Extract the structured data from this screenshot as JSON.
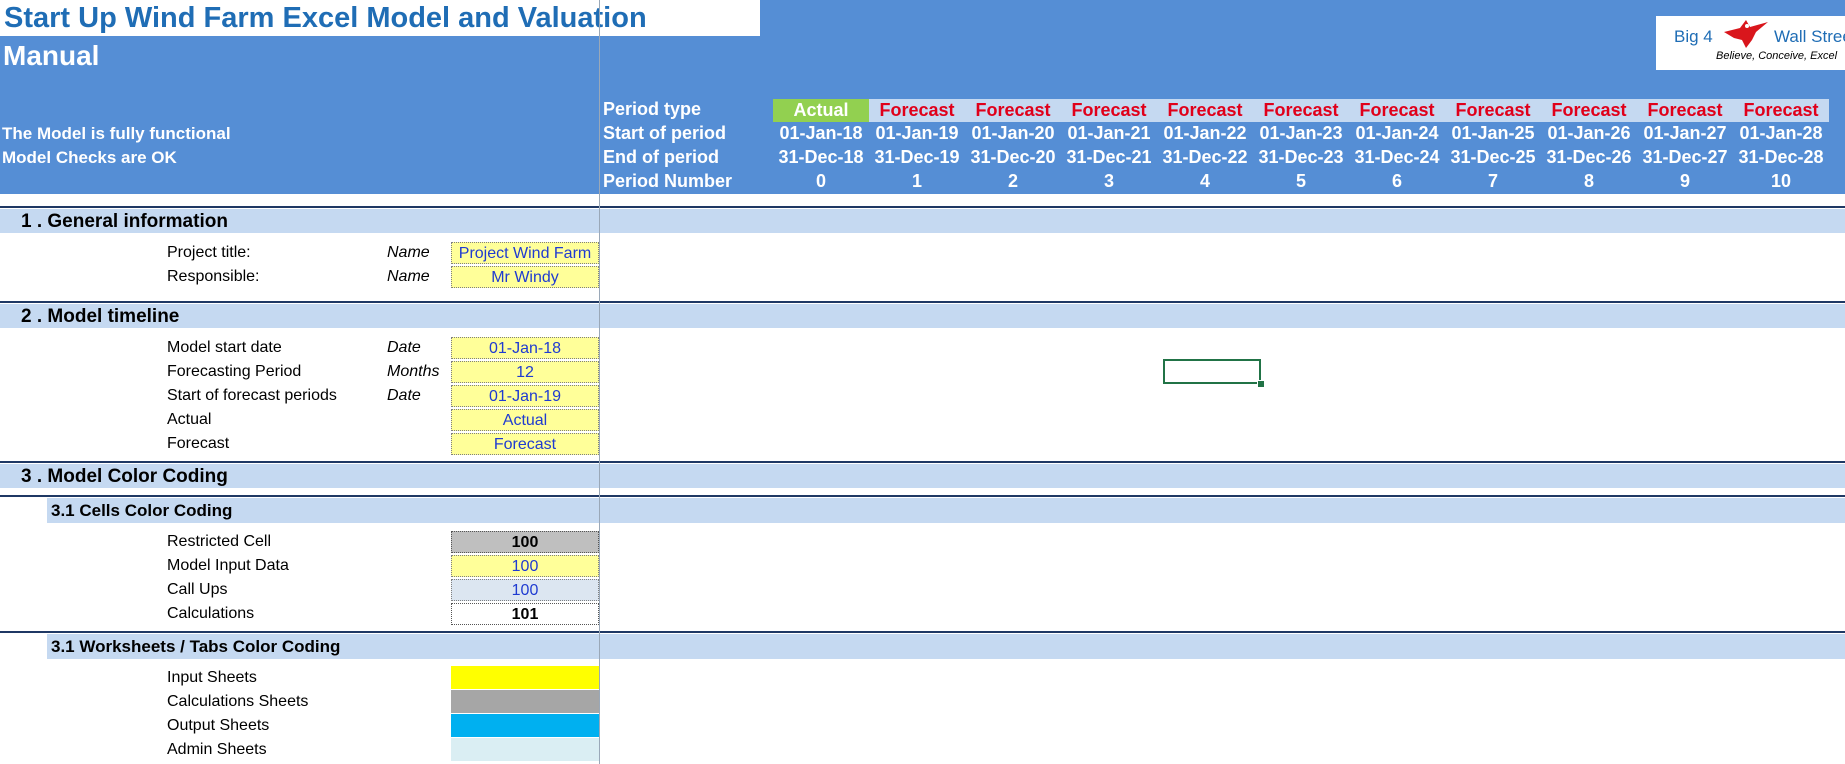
{
  "header": {
    "title": "Start Up Wind Farm Excel Model and Valuation",
    "subtitle": "Manual",
    "status_functional": "The Model is fully functional",
    "status_checks": "Model Checks are OK",
    "row_labels": {
      "period_type": "Period type",
      "start": "Start of period",
      "end": "End of period",
      "number": "Period Number"
    },
    "periods": [
      {
        "type": "Actual",
        "start": "01-Jan-18",
        "end": "31-Dec-18",
        "number": "0"
      },
      {
        "type": "Forecast",
        "start": "01-Jan-19",
        "end": "31-Dec-19",
        "number": "1"
      },
      {
        "type": "Forecast",
        "start": "01-Jan-20",
        "end": "31-Dec-20",
        "number": "2"
      },
      {
        "type": "Forecast",
        "start": "01-Jan-21",
        "end": "31-Dec-21",
        "number": "3"
      },
      {
        "type": "Forecast",
        "start": "01-Jan-22",
        "end": "31-Dec-22",
        "number": "4"
      },
      {
        "type": "Forecast",
        "start": "01-Jan-23",
        "end": "31-Dec-23",
        "number": "5"
      },
      {
        "type": "Forecast",
        "start": "01-Jan-24",
        "end": "31-Dec-24",
        "number": "6"
      },
      {
        "type": "Forecast",
        "start": "01-Jan-25",
        "end": "31-Dec-25",
        "number": "7"
      },
      {
        "type": "Forecast",
        "start": "01-Jan-26",
        "end": "31-Dec-26",
        "number": "8"
      },
      {
        "type": "Forecast",
        "start": "01-Jan-27",
        "end": "31-Dec-27",
        "number": "9"
      },
      {
        "type": "Forecast",
        "start": "01-Jan-28",
        "end": "31-Dec-28",
        "number": "10"
      }
    ]
  },
  "logo": {
    "text_left": "Big 4",
    "text_right": "Wall Street",
    "tagline": "Believe, Conceive, Excel",
    "icon": "eagle-icon"
  },
  "sections": {
    "general": {
      "title": "1 . General information",
      "rows": [
        {
          "label": "Project title:",
          "unit": "Name",
          "value": "Project Wind Farm"
        },
        {
          "label": "Responsible:",
          "unit": "Name",
          "value": "Mr Windy"
        }
      ]
    },
    "timeline": {
      "title": "2 . Model timeline",
      "rows": [
        {
          "label": "Model start date",
          "unit": "Date",
          "value": "01-Jan-18"
        },
        {
          "label": "Forecasting Period",
          "unit": "Months",
          "value": "12"
        },
        {
          "label": "Start of forecast periods",
          "unit": "Date",
          "value": "01-Jan-19"
        },
        {
          "label": "Actual",
          "unit": "",
          "value": "Actual"
        },
        {
          "label": "Forecast",
          "unit": "",
          "value": "Forecast"
        }
      ]
    },
    "coding": {
      "title": "3 . Model Color Coding",
      "cells_title": "3.1 Cells Color Coding",
      "cells": [
        {
          "label": "Restricted Cell",
          "value": "100"
        },
        {
          "label": "Model Input Data",
          "value": "100"
        },
        {
          "label": "Call Ups",
          "value": "100"
        },
        {
          "label": "Calculations",
          "value": "101"
        }
      ],
      "tabs_title": "3.1 Worksheets / Tabs Color Coding",
      "tabs": [
        {
          "label": "Input Sheets",
          "color": "#ffff00"
        },
        {
          "label": "Calculations Sheets",
          "color": "#a6a6a6"
        },
        {
          "label": "Output Sheets",
          "color": "#00b0f0"
        },
        {
          "label": "Admin Sheets",
          "color": "#daeef3"
        }
      ]
    }
  },
  "colors": {
    "header_bg": "#558ed5",
    "section_bg": "#c5d9f1",
    "actual_bg": "#92d050",
    "forecast_text": "#e0001a",
    "input_bg": "#ffff99"
  }
}
